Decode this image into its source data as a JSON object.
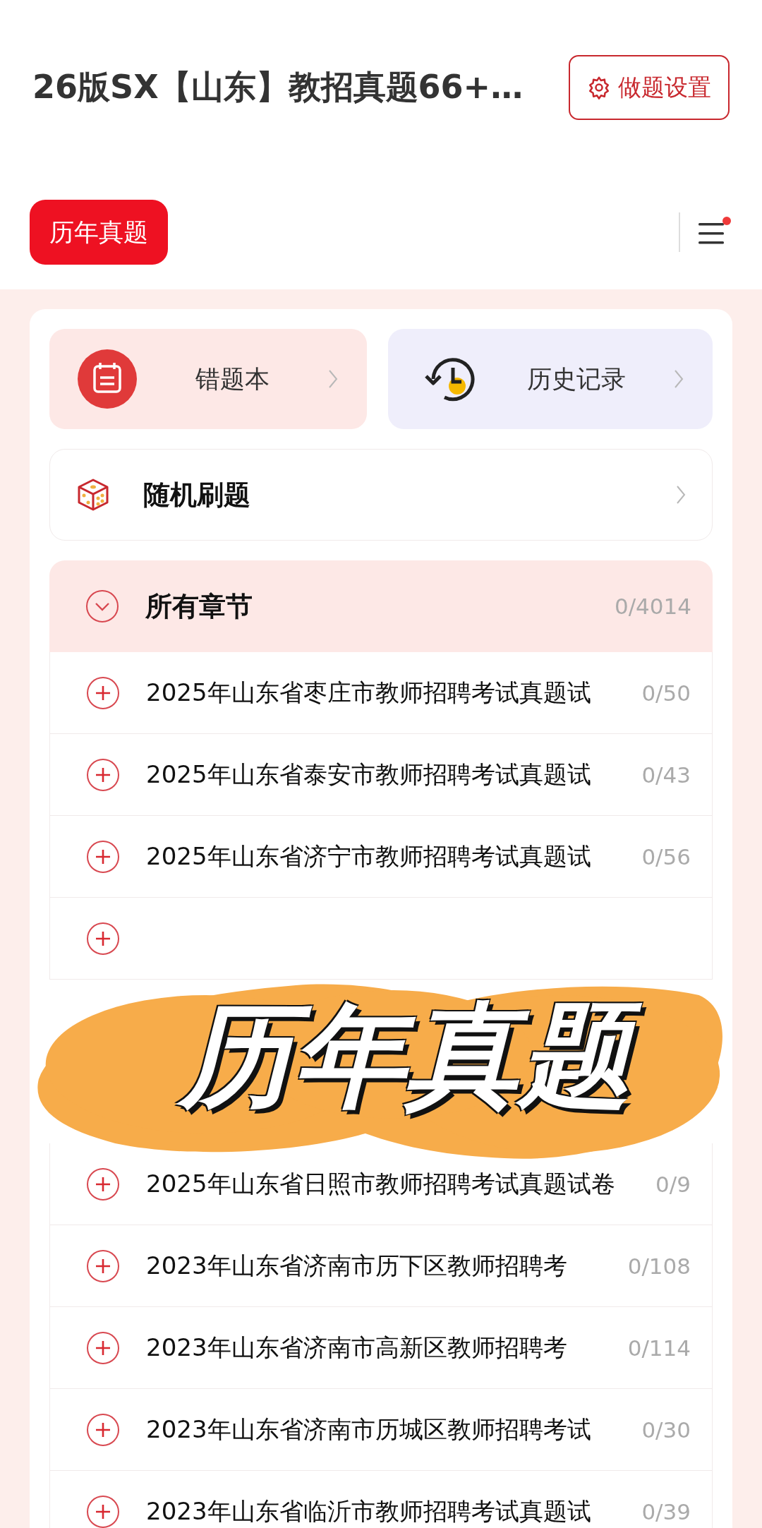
{
  "header": {
    "title": "26版SX【山东】教招真题66+…",
    "settings_button": "做题设置"
  },
  "tabs": [
    {
      "label": "历年真题",
      "selected": true
    }
  ],
  "menu": {
    "has_notice": true
  },
  "shortcuts": [
    {
      "kind": "wrong",
      "label": "错题本"
    },
    {
      "kind": "history",
      "label": "历史记录"
    }
  ],
  "random_practice": {
    "label": "随机刷题"
  },
  "section": {
    "title": "所有章节",
    "count": "0/4014",
    "expanded": true
  },
  "rows": [
    {
      "kind": "chapter",
      "title": "2025年山东省枣庄市教师招聘考试真题试",
      "count": "0/50"
    },
    {
      "kind": "chapter",
      "title": "2025年山东省泰安市教师招聘考试真题试",
      "count": "0/43"
    },
    {
      "kind": "chapter",
      "title": "2025年山东省济宁市教师招聘考试真题试",
      "count": "0/56"
    },
    {
      "kind": "covered"
    },
    {
      "kind": "hidden"
    },
    {
      "kind": "hidden"
    },
    {
      "kind": "chapter",
      "title": "2025年山东省日照市教师招聘考试真题试卷",
      "count": "0/9"
    },
    {
      "kind": "chapter",
      "title": "2023年山东省济南市历下区教师招聘考",
      "count": "0/108"
    },
    {
      "kind": "chapter",
      "title": "2023年山东省济南市高新区教师招聘考",
      "count": "0/114"
    },
    {
      "kind": "chapter",
      "title": "2023年山东省济南市历城区教师招聘考试",
      "count": "0/30"
    },
    {
      "kind": "chapter",
      "title": "2023年山东省临沂市教师招聘考试真题试",
      "count": "0/39"
    }
  ],
  "overlay": {
    "text": "历年真题"
  }
}
